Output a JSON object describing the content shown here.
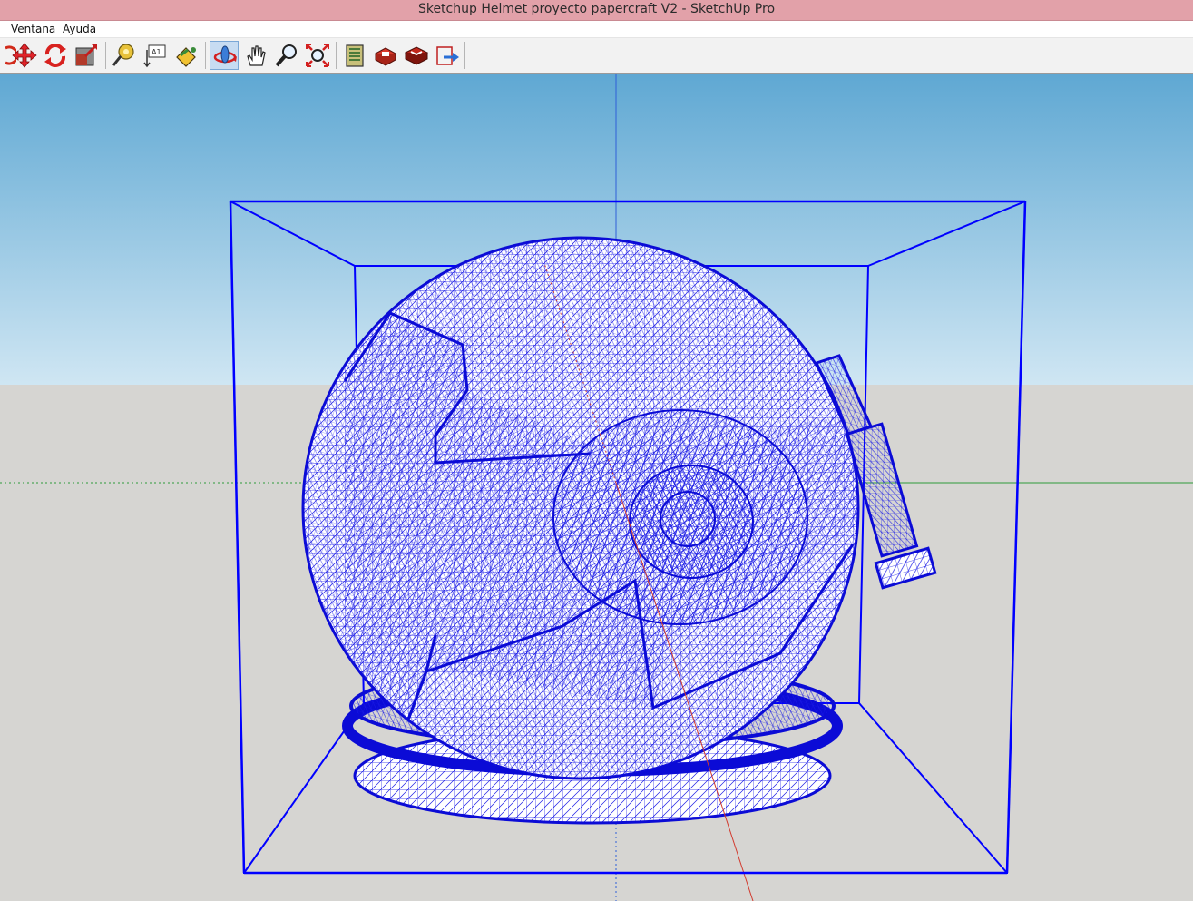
{
  "window": {
    "title": "Sketchup Helmet proyecto papercraft V2 - SketchUp Pro"
  },
  "menu": {
    "items": [
      {
        "label": "Ventana"
      },
      {
        "label": "Ayuda"
      }
    ]
  },
  "toolbar": {
    "tools": [
      {
        "name": "rotate-icon",
        "active": false
      },
      {
        "name": "move-icon",
        "active": false
      },
      {
        "name": "follow-me-icon",
        "active": false
      },
      {
        "name": "scale-icon",
        "active": false
      },
      {
        "name": "tape-measure-icon",
        "active": false
      },
      {
        "name": "text-icon",
        "active": false
      },
      {
        "name": "paint-bucket-icon",
        "active": false
      },
      {
        "name": "orbit-icon",
        "active": true
      },
      {
        "name": "pan-icon",
        "active": false
      },
      {
        "name": "zoom-icon",
        "active": false
      },
      {
        "name": "zoom-extents-icon",
        "active": false
      },
      {
        "name": "warehouse-icon",
        "active": false
      },
      {
        "name": "share-model-icon",
        "active": false
      },
      {
        "name": "components-icon",
        "active": false
      },
      {
        "name": "export-icon",
        "active": false
      }
    ]
  },
  "colors": {
    "sky_top": "#5fa8d3",
    "sky_bottom": "#cfe6f3",
    "ground": "#d6d5d2",
    "wireframe": "#1010e0",
    "selection_box": "#0000ff",
    "axis_red": "#d23a2e",
    "axis_green": "#2e9a3a",
    "axis_blue": "#2f5fd8"
  }
}
